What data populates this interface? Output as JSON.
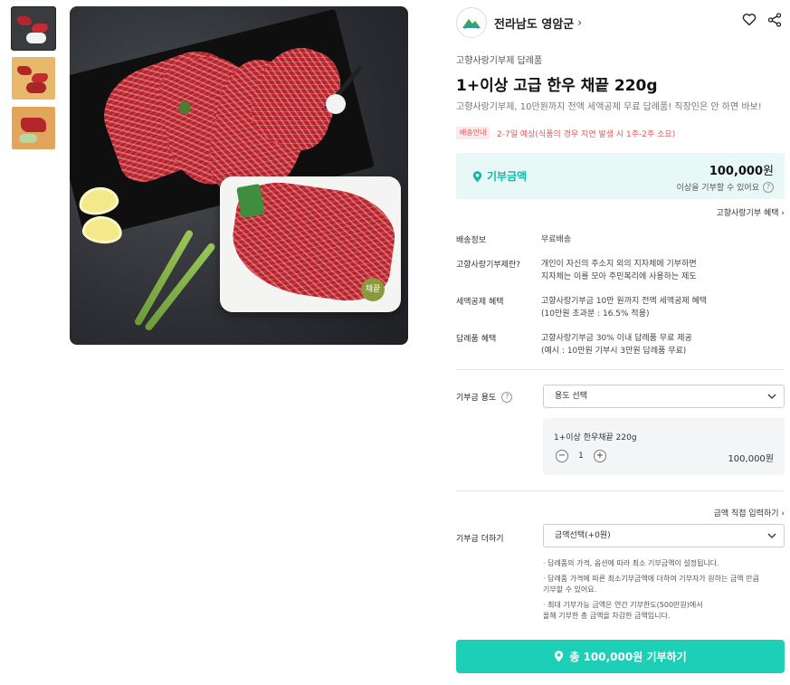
{
  "gallery": {
    "thumb_count": 3,
    "active_index": 0,
    "seal_text": "채끝"
  },
  "seller": {
    "name": "전라남도 영암군",
    "chevron": "›",
    "logo_icon": "mountain-logo-icon"
  },
  "product": {
    "category": "고향사랑기부제 답례품",
    "title": "1+이상 고급 한우 채끝 220g",
    "description": "고향사랑기부제, 10만원까지 전액 세액공제 무료 답례품! 직장인은 안 하면 바보!",
    "shipping_badge": "배송안내",
    "shipping_note": "2-7일 예상(식품의 경우 지연 발생 시 1주-2주 소요)"
  },
  "donation": {
    "label": "기부금액",
    "amount": "100,000",
    "amount_unit": "원",
    "sub": "이상을 기부할 수 있어요",
    "help": "?",
    "benefit_link": "고향사랑기부 혜택 ›"
  },
  "info": {
    "delivery_label": "배송정보",
    "delivery_value": "무료배송",
    "what_label": "고향사랑기부제란?",
    "what_line1": "개인이 자신의 주소지 외의 지자체에 기부하면",
    "what_line2": "지자체는 이를 모아 주민복리에 사용하는 제도",
    "tax_label": "세액공제 혜택",
    "tax_line1": "고향사랑기부금 10만 원까지 전액 세액공제 혜택",
    "tax_line2": "(10만원 초과분 : 16.5% 적용)",
    "gift_label": "답례품 혜택",
    "gift_line1": "고향사랑기부금 30% 이내 답례품 무료 제공",
    "gift_line2": "(예시 : 10만원 기부시 3만원 답례품 무료)"
  },
  "purpose": {
    "label": "기부금 용도",
    "help": "?",
    "select_value": "용도 선택"
  },
  "option": {
    "name": "1+이상 한우채끝 220g",
    "minus": "−",
    "quantity": "1",
    "plus": "+",
    "price": "100,000원"
  },
  "add": {
    "direct_link": "금액 직접 입력하기 ›",
    "label": "기부금 더하기",
    "select_value": "금액선택(+0원)",
    "note1": "· 답례품의 가격, 옵션에 따라 최소 기부금액이 설정됩니다.",
    "note2_line1": "· 답례품 가격에 따른 최소기부금액에 더하여 기부자가 원하는 금액 만큼",
    "note2_line2": "  기부할 수 있어요.",
    "note3_line1": "· 최대 기부가능 금액은 연간 기부한도(500만원)에서",
    "note3_line2": "  올해 기부한 총 금액을 차감한 금액입니다."
  },
  "cta": {
    "label": "총 100,000원 기부하기"
  },
  "colors": {
    "accent": "#1ccfb6",
    "accent_text": "#14b8a6",
    "accent_bg": "#e8f8f6",
    "alert": "#e05858"
  }
}
